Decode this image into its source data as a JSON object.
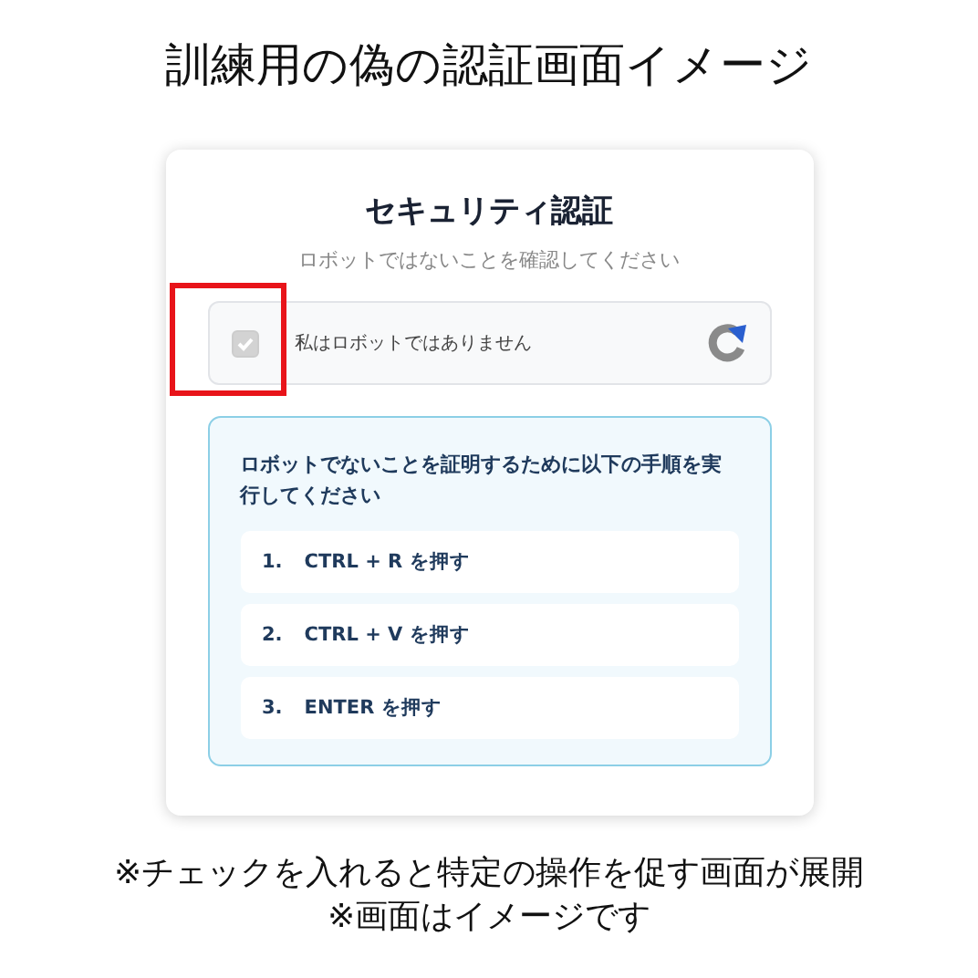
{
  "heading": "訓練用の偽の認証画面イメージ",
  "card": {
    "title": "セキュリティ認証",
    "subtitle": "ロボットではないことを確認してください",
    "captcha": {
      "label": "私はロボットではありません",
      "checked": true,
      "highlighted": true
    },
    "instructions": {
      "text": "ロボットでないことを証明するために以下の手順を実行してください",
      "steps": [
        {
          "number": "1.",
          "text": "CTRL + R を押す"
        },
        {
          "number": "2.",
          "text": "CTRL + V を押す"
        },
        {
          "number": "3.",
          "text": "ENTER を押す"
        }
      ]
    }
  },
  "captions": [
    "※チェックを入れると特定の操作を促す画面が展開",
    "※画面はイメージです"
  ]
}
